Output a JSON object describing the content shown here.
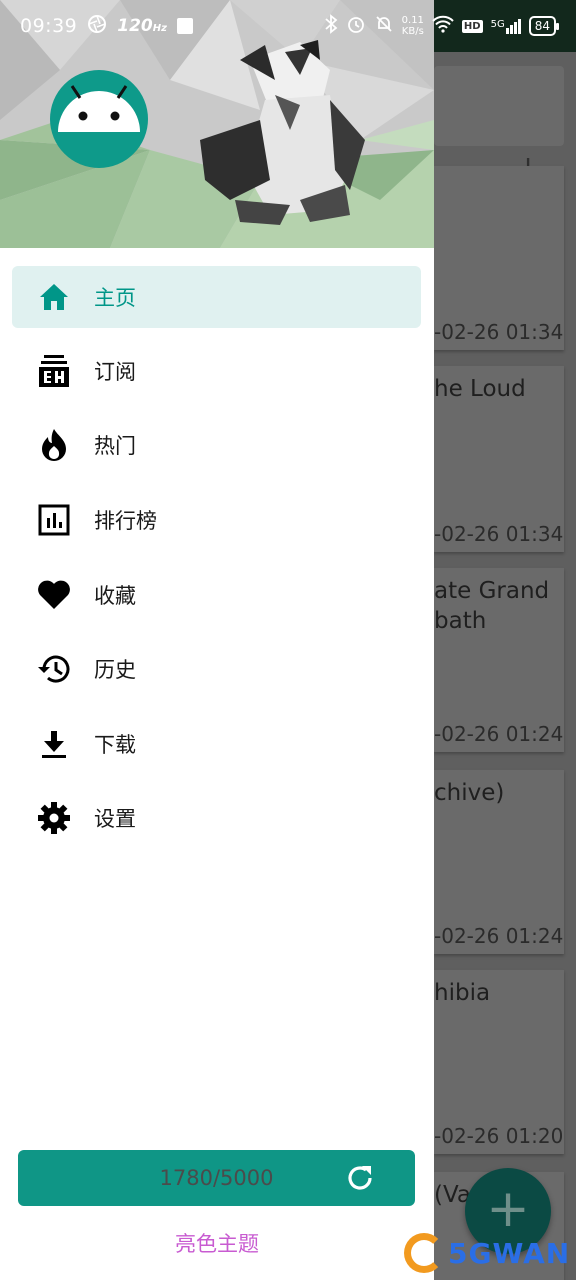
{
  "status_bar": {
    "time": "09:39",
    "refresh_rate": "120",
    "refresh_unit": "Hz",
    "net_speed": "0.11",
    "net_unit": "KB/s",
    "hd": "HD",
    "network": "5G",
    "battery": "84"
  },
  "drawer": {
    "menu": [
      {
        "label": "主页",
        "icon": "home-icon",
        "active": true
      },
      {
        "label": "订阅",
        "icon": "subscribe-eh-icon",
        "active": false
      },
      {
        "label": "热门",
        "icon": "fire-icon",
        "active": false
      },
      {
        "label": "排行榜",
        "icon": "bar-chart-icon",
        "active": false
      },
      {
        "label": "收藏",
        "icon": "heart-icon",
        "active": false
      },
      {
        "label": "历史",
        "icon": "history-icon",
        "active": false
      },
      {
        "label": "下载",
        "icon": "download-icon",
        "active": false
      },
      {
        "label": "设置",
        "icon": "settings-icon",
        "active": false
      }
    ],
    "quota": "1780/5000",
    "theme_toggle": "亮色主题"
  },
  "background": {
    "cards": [
      {
        "title": "",
        "time": "-02-26 01:34"
      },
      {
        "title": "he Loud",
        "time": "-02-26 01:34"
      },
      {
        "title": "ate Grand\nbath",
        "time": "-02-26 01:24"
      },
      {
        "title": "chive)",
        "time": "-02-26 01:24"
      },
      {
        "title": "hibia",
        "time": "-02-26 01:20"
      },
      {
        "title": "(Va",
        "time": ""
      }
    ],
    "fab_label": "+"
  },
  "watermark": "5GWAN",
  "colors": {
    "accent": "#009688",
    "active_bg": "#e0f1f0",
    "quota_bg": "#0f9686",
    "theme_text": "#c85bd1"
  }
}
